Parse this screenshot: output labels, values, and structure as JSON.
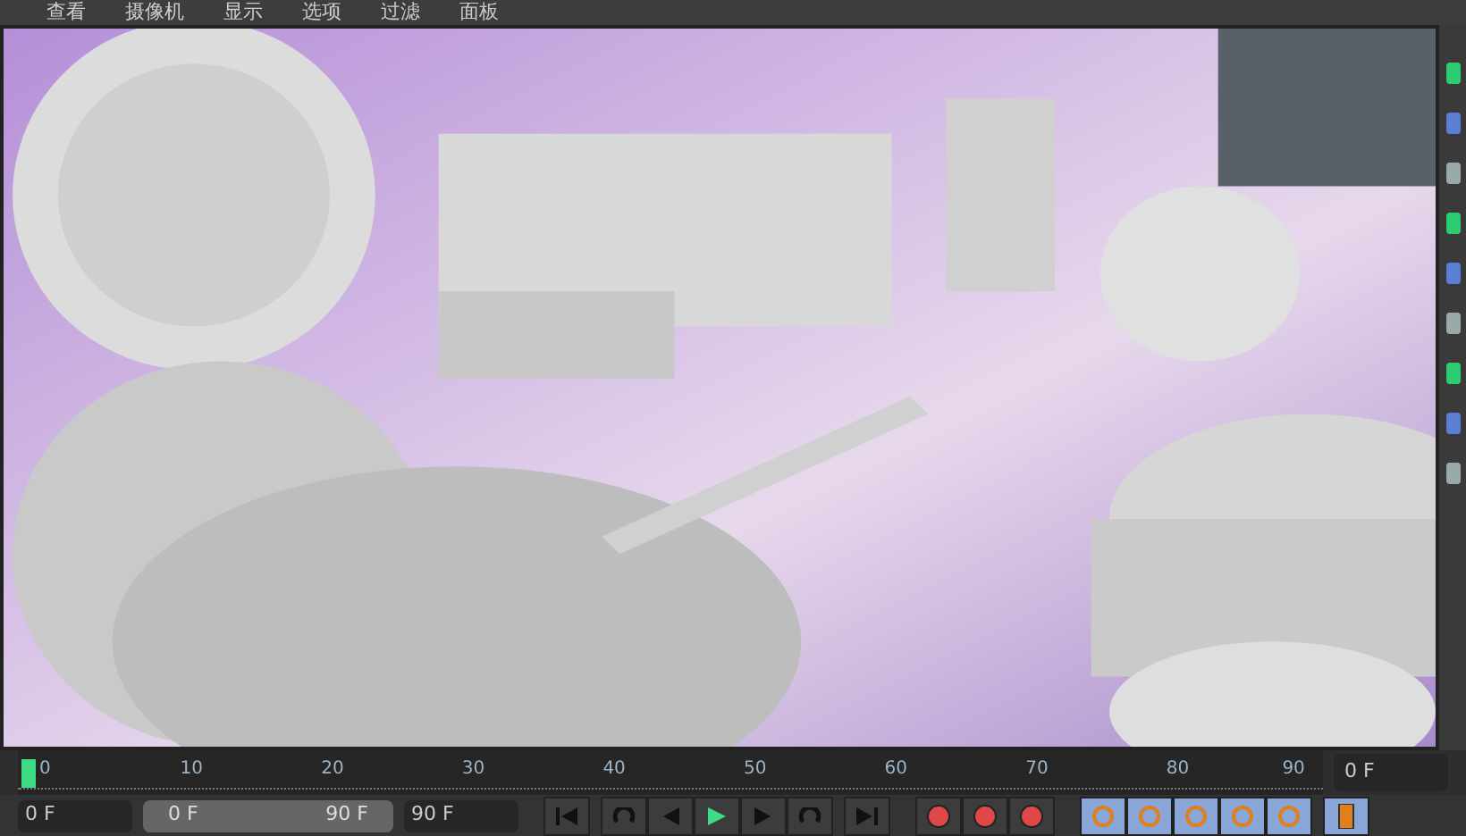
{
  "menu": [
    "查看",
    "摄像机",
    "显示",
    "选项",
    "过滤",
    "面板"
  ],
  "timeline": {
    "ticks": [
      "0",
      "10",
      "20",
      "30",
      "40",
      "50",
      "60",
      "70",
      "80",
      "90"
    ],
    "level": 0,
    "current_frame": "0 F"
  },
  "controls": {
    "start_frame": "0 F",
    "range_start": "0 F",
    "range_end": "90 F",
    "end_frame": "90 F"
  }
}
